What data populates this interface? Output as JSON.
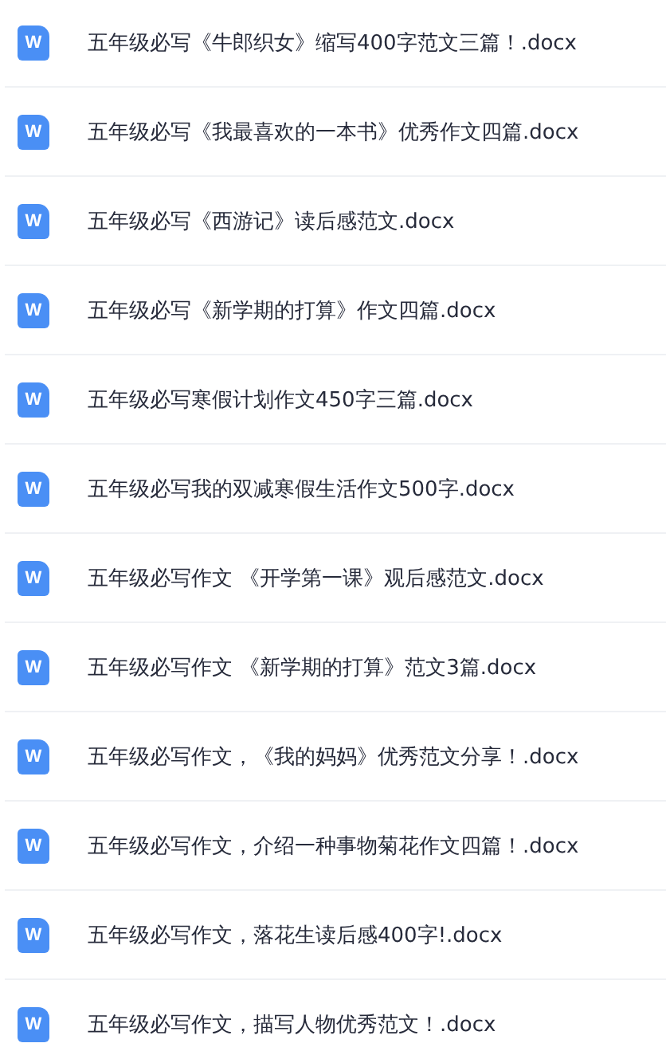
{
  "files": [
    {
      "icon_letter": "W",
      "name": "五年级必写《牛郎织女》缩写400字范文三篇！.docx"
    },
    {
      "icon_letter": "W",
      "name": "五年级必写《我最喜欢的一本书》优秀作文四篇.docx"
    },
    {
      "icon_letter": "W",
      "name": "五年级必写《西游记》读后感范文.docx"
    },
    {
      "icon_letter": "W",
      "name": "五年级必写《新学期的打算》作文四篇.docx"
    },
    {
      "icon_letter": "W",
      "name": "五年级必写寒假计划作文450字三篇.docx"
    },
    {
      "icon_letter": "W",
      "name": "五年级必写我的双减寒假生活作文500字.docx"
    },
    {
      "icon_letter": "W",
      "name": "五年级必写作文 《开学第一课》观后感范文.docx"
    },
    {
      "icon_letter": "W",
      "name": "五年级必写作文 《新学期的打算》范文3篇.docx"
    },
    {
      "icon_letter": "W",
      "name": "五年级必写作文，《我的妈妈》优秀范文分享！.docx"
    },
    {
      "icon_letter": "W",
      "name": "五年级必写作文，介绍一种事物菊花作文四篇！.docx"
    },
    {
      "icon_letter": "W",
      "name": "五年级必写作文，落花生读后感400字!.docx"
    },
    {
      "icon_letter": "W",
      "name": "五年级必写作文，描写人物优秀范文！.docx"
    }
  ]
}
